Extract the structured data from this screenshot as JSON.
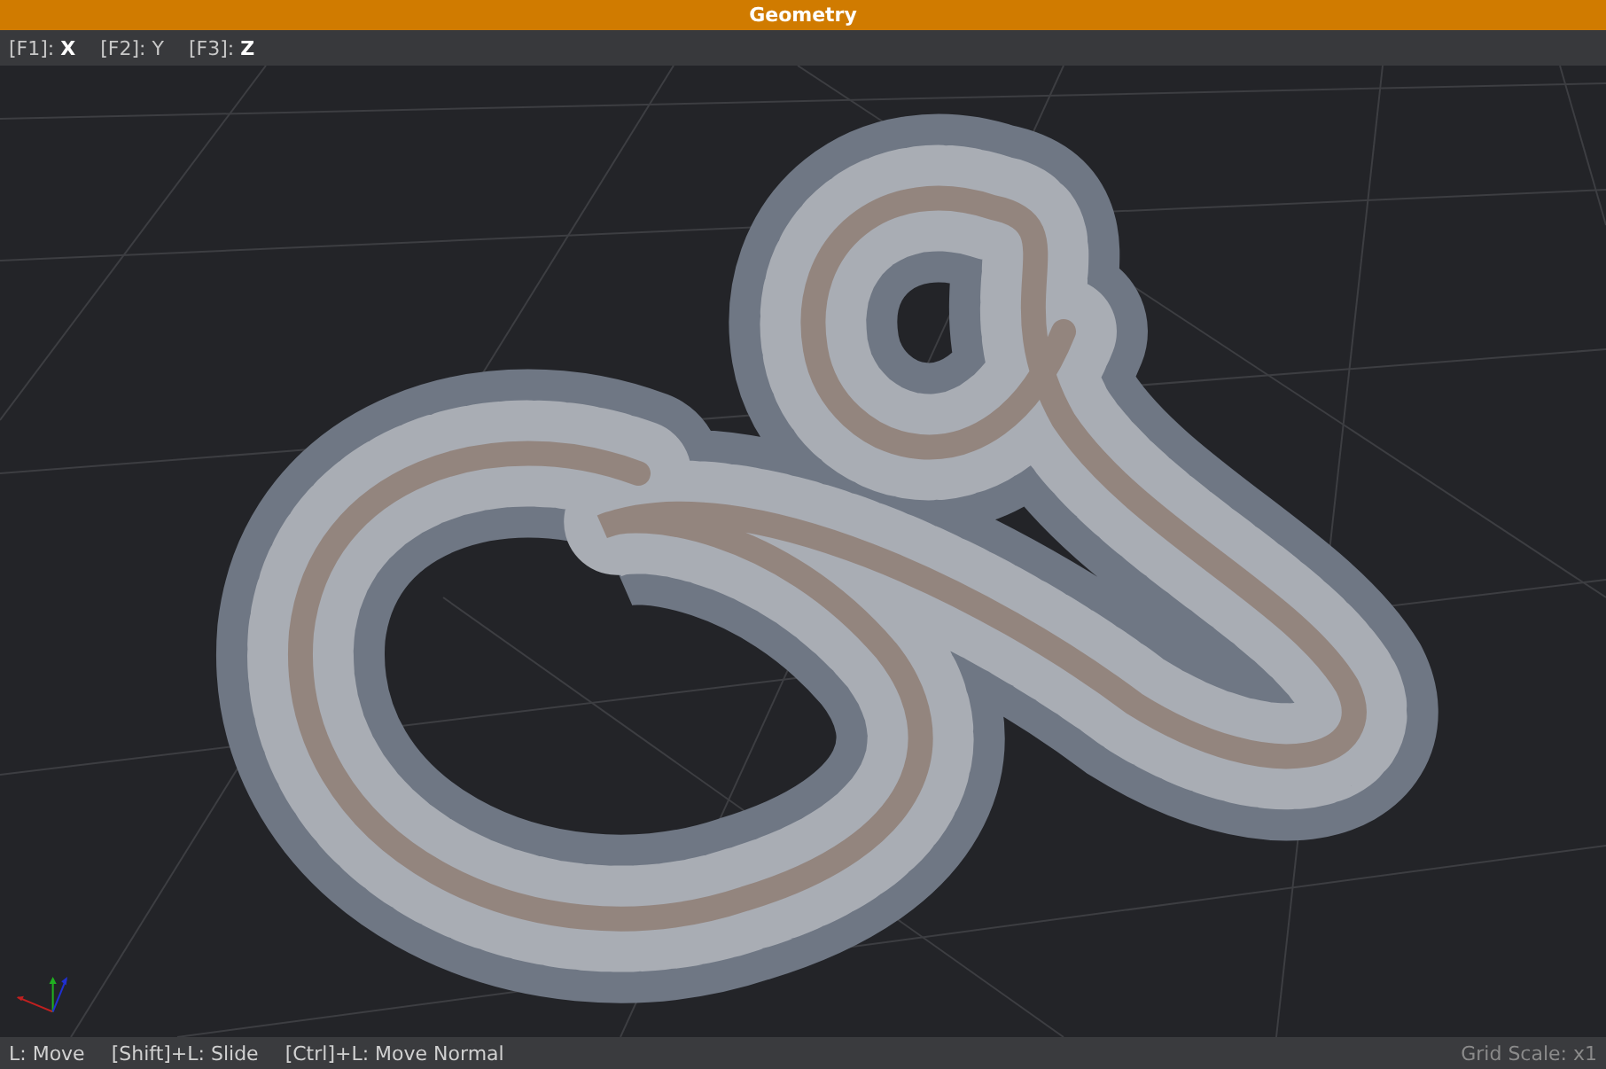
{
  "window": {
    "title": "Geometry"
  },
  "axis_toggles": [
    {
      "key": "[F1]:",
      "axis": "X",
      "on": true
    },
    {
      "key": "[F2]:",
      "axis": "Y",
      "on": false
    },
    {
      "key": "[F3]:",
      "axis": "Z",
      "on": true
    }
  ],
  "status_bar": {
    "hints": [
      "L: Move",
      "[Shift]+L: Slide",
      "[Ctrl]+L: Move Normal"
    ],
    "grid_scale": "Grid Scale: x1"
  }
}
